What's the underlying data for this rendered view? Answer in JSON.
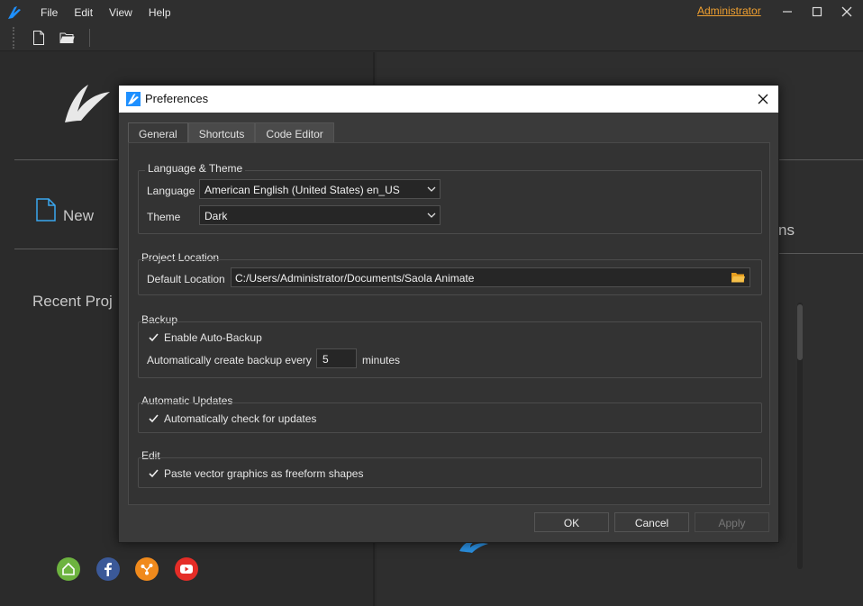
{
  "menu": [
    "File",
    "Edit",
    "View",
    "Help"
  ],
  "user": "Administrator",
  "welcome": {
    "new_label": "New",
    "recent_label": "Recent Proj",
    "right_partial": "ns"
  },
  "dialog": {
    "title": "Preferences",
    "tabs": [
      "General",
      "Shortcuts",
      "Code Editor"
    ],
    "active_tab": "General",
    "language_theme": {
      "title": "Language & Theme",
      "language_label": "Language",
      "language_value": "American English (United States)  en_US",
      "theme_label": "Theme",
      "theme_value": "Dark"
    },
    "project_location": {
      "title": "Project Location",
      "default_label": "Default Location",
      "path": "C:/Users/Administrator/Documents/Saola Animate"
    },
    "backup": {
      "title": "Backup",
      "auto_backup_label": "Enable Auto-Backup",
      "auto_backup_checked": true,
      "interval_prefix": "Automatically create backup every",
      "interval_value": "5",
      "interval_suffix": "minutes"
    },
    "updates": {
      "title": "Automatic Updates",
      "check_label": "Automatically check for updates",
      "checked": true
    },
    "edit": {
      "title": "Edit",
      "paste_label": "Paste vector graphics as freeform shapes",
      "checked": true
    },
    "buttons": {
      "ok": "OK",
      "cancel": "Cancel",
      "apply": "Apply"
    }
  },
  "colors": {
    "accent": "#f0a030",
    "logo_blue": "#1e90ff"
  }
}
